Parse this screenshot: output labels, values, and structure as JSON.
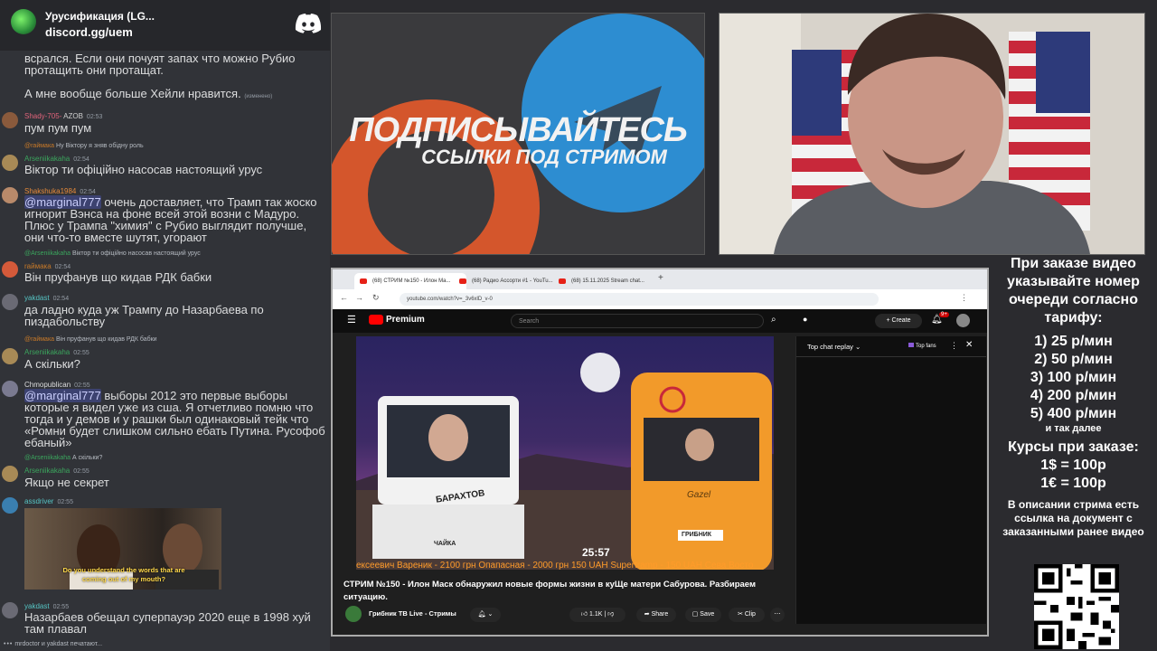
{
  "chat": {
    "server_name": "Урусификация (LG...",
    "server_link": "discord.gg/uem",
    "messages": [
      {
        "id": "m1",
        "text": "всрался. Если они почуят запах что можно Рубио протащить они протащат."
      },
      {
        "id": "m2",
        "text": "А мне вообще больше Хейли нравится.",
        "edited": "(изменено)"
      },
      {
        "id": "m3",
        "user": "Shady-705-",
        "badge": "AZOB",
        "time": "02:53",
        "text": "пум пум пум",
        "user_color": "#e0637a"
      },
      {
        "id": "m4",
        "reply_user": "@rаймака",
        "reply_text": "Ну Віктору я зняв обідну роль",
        "user": "Arseniikakaha",
        "time": "02:54",
        "text": "Віктор ти офіційно насосав настоящий урус",
        "user_color": "#3ba55d"
      },
      {
        "id": "m5",
        "user": "Shakshuka1984",
        "time": "02:54",
        "mention": "@marginal777",
        "text": " очень доставляет, что Трамп так жоско игнорит Вэнса на фоне всей этой возни с Мадуро. Плюс у Трампа \"химия\" с Рубио выглядит получше, они что-то вместе шутят, угорают",
        "user_color": "#e88b3a"
      },
      {
        "id": "m6",
        "reply_user": "@Arseniikakaha",
        "reply_text": "Віктор ти офіційно насосав настоящий урус",
        "user": "rаймака",
        "time": "02:54",
        "text": "Він пруфанув що кидав РДК бабки",
        "user_color": "#c97a28"
      },
      {
        "id": "m7",
        "user": "yakdast",
        "time": "02:54",
        "text": "да ладно куда уж Трампу до Назарбаева по пиздабольству",
        "user_color": "#56c4c4"
      },
      {
        "id": "m8",
        "reply_user": "@rаймака",
        "reply_text": "Він пруфанув що кидав РДК бабки",
        "user": "Arseniikakaha",
        "time": "02:55",
        "text": "А скільки?",
        "user_color": "#3ba55d"
      },
      {
        "id": "m9",
        "user": "Chmopublican",
        "time": "02:55",
        "mention": "@marginal777",
        "text": " выборы 2012 это первые выборы которые я видел уже из сша. Я отчетливо помню что тогда и у демов и у рашки был одинаковый тейк что «Ромни будет слишком сильно ебать Путина. Русофоб ебаный»",
        "user_color": "#dcddde"
      },
      {
        "id": "m10",
        "reply_user": "@Arseniikakaha",
        "reply_text": "А скільки?",
        "user": "Arseniikakaha",
        "time": "02:55",
        "text": "Якщо не секрет",
        "user_color": "#3ba55d"
      },
      {
        "id": "m11",
        "user": "assdriver",
        "time": "02:55",
        "text": "",
        "user_color": "#56c4c4",
        "image_caption": "Do you understand the words that are coming out of my mouth?"
      },
      {
        "id": "m12",
        "user": "yakdast",
        "time": "02:55",
        "text": "Назарбаев обещал суперпауэр 2020 еще в 1998 хуй там плавал",
        "user_color": "#56c4c4"
      }
    ],
    "typing": "mrdoctor и yakdast печатают..."
  },
  "banner": {
    "title": "ПОДПИСЫВАЙТЕСЬ",
    "subtitle": "ССЫЛКИ ПОД СТРИМОМ"
  },
  "browser": {
    "tabs": [
      {
        "label": "(68) СТРИМ №150 - Илон Ма..."
      },
      {
        "label": "(68) Радио Ассорти #1 - YouTu..."
      },
      {
        "label": "(68) 15.11.2025 Stream chat..."
      }
    ],
    "url": "youtube.com/watch?v=_3v6xlD_v-0",
    "yt_logo": "Premium",
    "search_placeholder": "Search",
    "create_label": "Create",
    "notifications": "9+",
    "video_title": "СТРИМ №150 - Илон Маск обнаружил новые формы жизни в куЩе матери Сабурова. Разбираем ситуацию.",
    "channel_name": "Грибник ТВ Live - Стримы",
    "likes": "1.1K",
    "share_label": "Share",
    "save_label": "Save",
    "clip_label": "Clip",
    "video_time": "25:57",
    "ticker": "ексеевич Вареник - 2100 грн  Опапасная - 2000 грн 150 UAH  Supertramp - 150 UAH  Сева Восто",
    "van_labels": {
      "left": "БАРАХТОВ",
      "plate_left": "ЧАЙКА",
      "plate_right": "ГРИБНИК",
      "van_brand": "Gazel"
    },
    "chat_replay_label": "Top chat replay",
    "top_fans_label": "Top fans"
  },
  "info": {
    "heading": "При заказе видео указывайте номер очереди согласно тарифу:",
    "tariffs": [
      "1) 25 р/мин",
      "2) 50 р/мин",
      "3) 100 р/мин",
      "4) 200 р/мин",
      "5) 400 р/мин"
    ],
    "tariffs_more": "и так далее",
    "rates_heading": "Курсы при заказе:",
    "rates": [
      "1$ = 100р",
      "1€ = 100р"
    ],
    "description": "В описании стрима есть ссылка на документ с заказанными ранее видео"
  }
}
